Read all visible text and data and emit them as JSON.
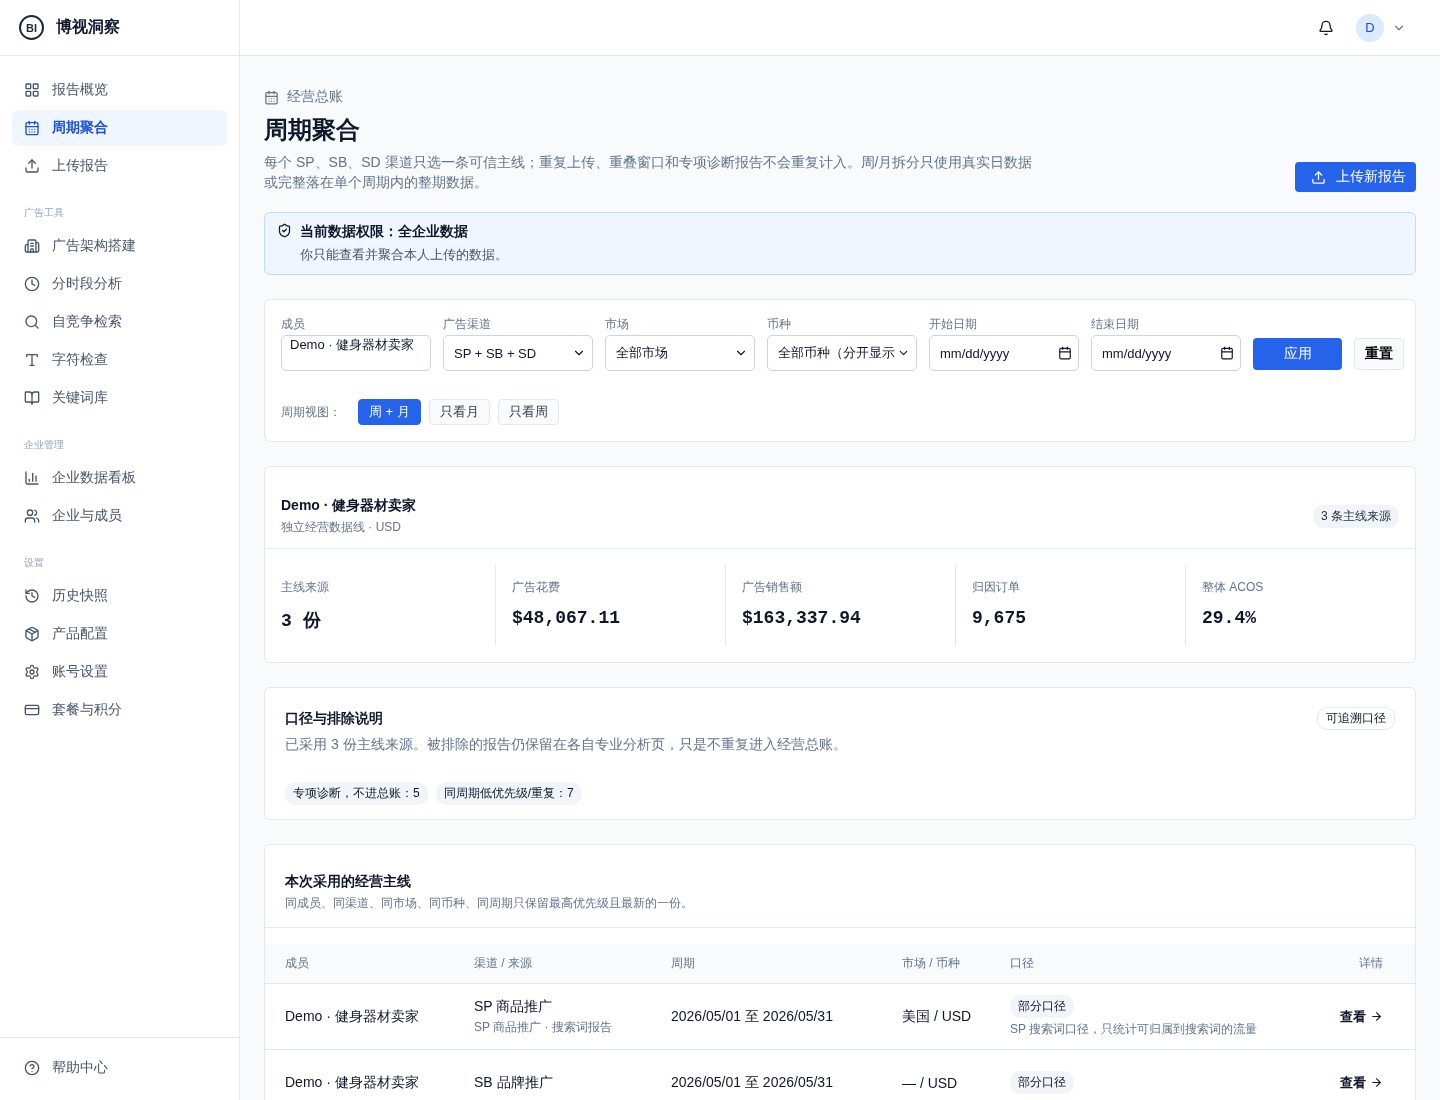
{
  "brand": {
    "logo": "BI",
    "name": "博视洞察"
  },
  "sidebar": {
    "items": [
      {
        "kind": "grid",
        "label": "报告概览",
        "selected": false
      },
      {
        "kind": "calendar",
        "label": "周期聚合",
        "selected": true
      },
      {
        "kind": "upload",
        "label": "上传报告",
        "selected": false
      }
    ],
    "sections": [
      {
        "title": "广告工具",
        "items": [
          {
            "kind": "building",
            "label": "广告架构搭建",
            "selected": false
          },
          {
            "kind": "clock",
            "label": "分时段分析",
            "selected": false
          },
          {
            "kind": "search",
            "label": "自竞争检索",
            "selected": false
          },
          {
            "kind": "type",
            "label": "字符检查",
            "selected": false
          },
          {
            "kind": "book",
            "label": "关键词库",
            "selected": false
          }
        ]
      },
      {
        "title": "企业管理",
        "items": [
          {
            "kind": "chart",
            "label": "企业数据看板",
            "selected": false
          },
          {
            "kind": "users",
            "label": "企业与成员",
            "selected": false
          }
        ]
      },
      {
        "title": "设置",
        "items": [
          {
            "kind": "history",
            "label": "历史快照",
            "selected": false
          },
          {
            "kind": "box",
            "label": "产品配置",
            "selected": false
          },
          {
            "kind": "gear",
            "label": "账号设置",
            "selected": false
          },
          {
            "kind": "card",
            "label": "套餐与积分",
            "selected": false
          }
        ]
      }
    ],
    "footer": {
      "label": "帮助中心"
    }
  },
  "header": {
    "avatar": "D"
  },
  "page": {
    "breadcrumb": "经营总账",
    "title": "周期聚合",
    "description": "每个 SP、SB、SD 渠道只选一条可信主线；重复上传、重叠窗口和专项诊断报告不会重复计入。周/月拆分只使用真实日数据或完整落在单个周期内的整期数据。",
    "upload_button": "上传新报告"
  },
  "notice": {
    "title": "当前数据权限：全企业数据",
    "text": "你只能查看并聚合本人上传的数据。"
  },
  "filters": {
    "fields": [
      {
        "kind": "text",
        "label": "成员",
        "value": "Demo · 健身器材卖家"
      },
      {
        "kind": "select",
        "label": "广告渠道",
        "value": "SP + SB + SD"
      },
      {
        "kind": "select",
        "label": "市场",
        "value": "全部市场"
      },
      {
        "kind": "select",
        "label": "币种",
        "value": "全部币种（分开显示"
      },
      {
        "kind": "date",
        "label": "开始日期",
        "value": "mm/dd/yyyy"
      },
      {
        "kind": "date",
        "label": "结束日期",
        "value": "mm/dd/yyyy"
      }
    ],
    "apply": "应用",
    "reset": "重置",
    "view_label": "周期视图：",
    "views": [
      {
        "label": "周 + 月",
        "selected": true
      },
      {
        "label": "只看月",
        "selected": false
      },
      {
        "label": "只看周",
        "selected": false
      }
    ]
  },
  "summary": {
    "title": "Demo · 健身器材卖家",
    "subtitle": "独立经营数据线 · USD",
    "badge": "3 条主线来源",
    "metrics": [
      {
        "label": "主线来源",
        "value": "3 份"
      },
      {
        "label": "广告花费",
        "value": "$48,067.11"
      },
      {
        "label": "广告销售额",
        "value": "$163,337.94"
      },
      {
        "label": "归因订单",
        "value": "9,675"
      },
      {
        "label": "整体 ACOS",
        "value": "29.4%"
      }
    ]
  },
  "scope": {
    "title": "口径与排除说明",
    "badge": "可追溯口径",
    "text": "已采用 3 份主线来源。被排除的报告仍保留在各自专业分析页，只是不重复进入经营总账。",
    "tags": [
      "专项诊断，不进总账：5",
      "同周期低优先级/重复：7"
    ]
  },
  "table": {
    "title": "本次采用的经营主线",
    "subtitle": "同成员、同渠道、同市场、同币种、同周期只保留最高优先级且最新的一份。",
    "columns": [
      "成员",
      "渠道 / 来源",
      "周期",
      "市场 / 币种",
      "口径",
      "详情"
    ],
    "rows": [
      {
        "member": "Demo · 健身器材卖家",
        "channel": "SP 商品推广",
        "source": "SP 商品推广 · 搜索词报告",
        "period": "2026/05/01 至 2026/05/31",
        "market": "美国 / USD",
        "scope_tag": "部分口径",
        "scope_note": "SP 搜索词口径，只统计可归属到搜索词的流量",
        "link": "查看"
      },
      {
        "member": "Demo · 健身器材卖家",
        "channel": "SB 品牌推广",
        "period": "2026/05/01 至 2026/05/31",
        "market": "— / USD",
        "scope_tag": "部分口径",
        "link": "查看"
      }
    ]
  }
}
